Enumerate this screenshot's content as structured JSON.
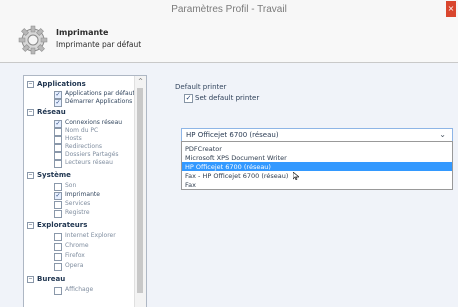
{
  "window": {
    "title": "Paramètres Profil - Travail",
    "close": "×"
  },
  "header": {
    "title": "Imprimante",
    "subtitle": "Imprimante par défaut"
  },
  "tree": {
    "groups": [
      {
        "label": "Applications",
        "items": [
          {
            "label": "Applications par défaut",
            "checked": true
          },
          {
            "label": "Démarrer Applications",
            "checked": true
          }
        ]
      },
      {
        "label": "Réseau",
        "items": [
          {
            "label": "Connexions réseau",
            "checked": true
          },
          {
            "label": "Nom du PC",
            "checked": false
          },
          {
            "label": "Hosts",
            "checked": false
          },
          {
            "label": "Redirections",
            "checked": false
          },
          {
            "label": "Dossiers Partagés",
            "checked": false
          },
          {
            "label": "Lecteurs réseau",
            "checked": false
          }
        ]
      },
      {
        "label": "Système",
        "items": [
          {
            "label": "Son",
            "checked": false
          },
          {
            "label": "Imprimante",
            "checked": true
          },
          {
            "label": "Services",
            "checked": false
          },
          {
            "label": "Registre",
            "checked": false
          }
        ]
      },
      {
        "label": "Explorateurs",
        "items": [
          {
            "label": "Internet Explorer",
            "checked": false
          },
          {
            "label": "Chrome",
            "checked": false
          },
          {
            "label": "Firefox",
            "checked": false
          },
          {
            "label": "Opera",
            "checked": false
          }
        ]
      },
      {
        "label": "Bureau",
        "items": [
          {
            "label": "Affichage",
            "checked": false
          }
        ]
      }
    ]
  },
  "content": {
    "section_title": "Default printer",
    "set_default_label": "Set default printer",
    "set_default_checked": true,
    "selected_printer": "HP Officejet 6700 (réseau)",
    "printer_options": [
      "PDFCreator",
      "Microsoft XPS Document Writer",
      "HP Officejet 6700 (réseau)",
      "Fax - HP Officejet 6700 (réseau)",
      "Fax"
    ],
    "selected_option_index": 2
  },
  "colors": {
    "selection": "#3399ff",
    "focus": "#8eb5e6",
    "close": "#d9462e"
  }
}
